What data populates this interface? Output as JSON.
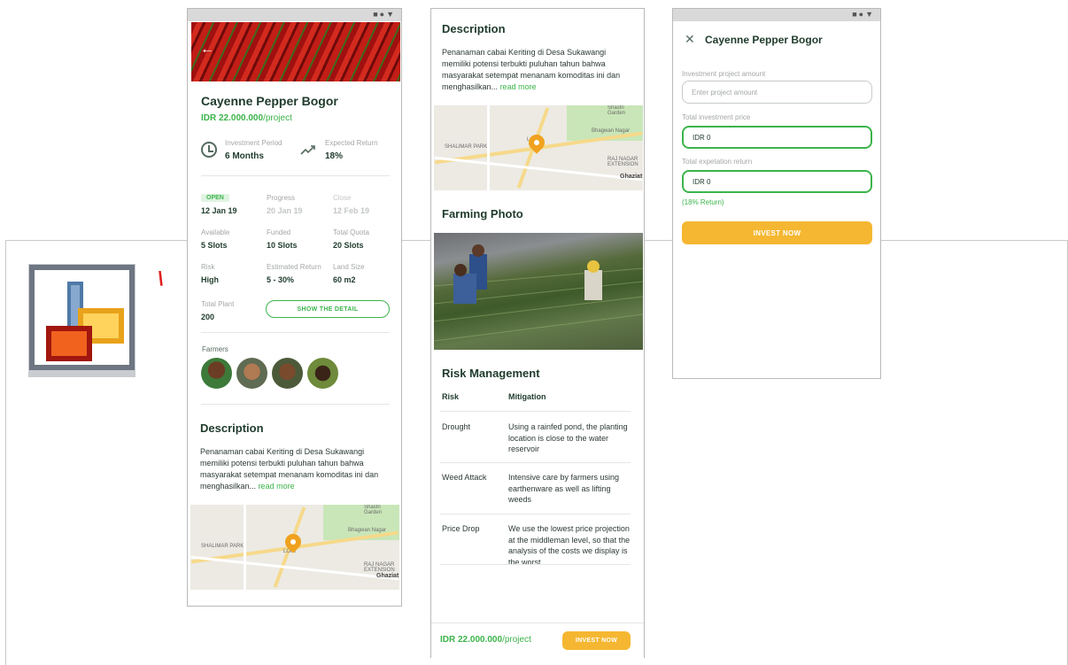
{
  "project": {
    "title": "Cayenne Pepper Bogor",
    "price": "IDR 22.000.000",
    "price_unit": "/project"
  },
  "metrics": {
    "period_label": "Investment Period",
    "period_value": "6 Months",
    "return_label": "Expected Return",
    "return_value": "18%"
  },
  "status": {
    "open_badge": "OPEN",
    "open_date": "12 Jan 19",
    "progress_label": "Progress",
    "progress_date": "20 Jan 19",
    "close_label": "Close",
    "close_date": "12 Feb 19",
    "available_label": "Available",
    "available_value": "5 Slots",
    "funded_label": "Funded",
    "funded_value": "10 Slots",
    "quota_label": "Total Quota",
    "quota_value": "20 Slots",
    "risk_label": "Risk",
    "risk_value": "High",
    "est_return_label": "Estimated Return",
    "est_return_value": "5 - 30%",
    "land_label": "Land Size",
    "land_value": "60 m2",
    "plant_label": "Total Plant",
    "plant_value": "200",
    "show_detail": "SHOW THE DETAIL"
  },
  "farmers": {
    "label": "Farmers"
  },
  "description": {
    "heading": "Description",
    "text": "Penanaman cabai Keriting di Desa Sukawangi memiliki potensi  terbukti puluhan tahun bahwa masyarakat setempat menanam komoditas ini dan menghasilkan...",
    "read_more": "read more"
  },
  "map_labels": {
    "ghaziat": "Ghaziat",
    "l1": "Shastri Garden",
    "l2": "Bhagwan Nagar",
    "l3": "RAJ NAGAR EXTENSION",
    "l4": "SHALIMAR PARK",
    "l5": "LONI"
  },
  "farming_photo": {
    "heading": "Farming Photo"
  },
  "risk_management": {
    "heading": "Risk Management",
    "col_risk": "Risk",
    "col_mitigation": "Mitigation",
    "rows": [
      {
        "risk": "Drought",
        "mitigation": "Using a rainfed pond, the planting location is close to the water reservoir"
      },
      {
        "risk": "Weed Attack",
        "mitigation": "Intensive care by farmers using earthenware as well as lifting weeds"
      },
      {
        "risk": "Price Drop",
        "mitigation": "We use the lowest price projection at the middleman level, so that the analysis of the costs we display is the worst"
      }
    ]
  },
  "footer": {
    "price": "IDR 22.000.000",
    "unit": "/project",
    "invest_button": "INVEST NOW"
  },
  "invest_form": {
    "title": "Cayenne Pepper Bogor",
    "amount_label": "Investment project amount",
    "amount_placeholder": "Enter project amount",
    "total_price_label": "Total investment price",
    "total_price_value": "IDR 0",
    "return_label": "Total expetation return",
    "return_value": "IDR 0",
    "return_note": "(18% Return)",
    "invest_button": "INVEST NOW"
  },
  "colors": {
    "accent_green": "#3bb44a",
    "accent_orange": "#f5b731",
    "text_dark": "#1f3b2c"
  }
}
